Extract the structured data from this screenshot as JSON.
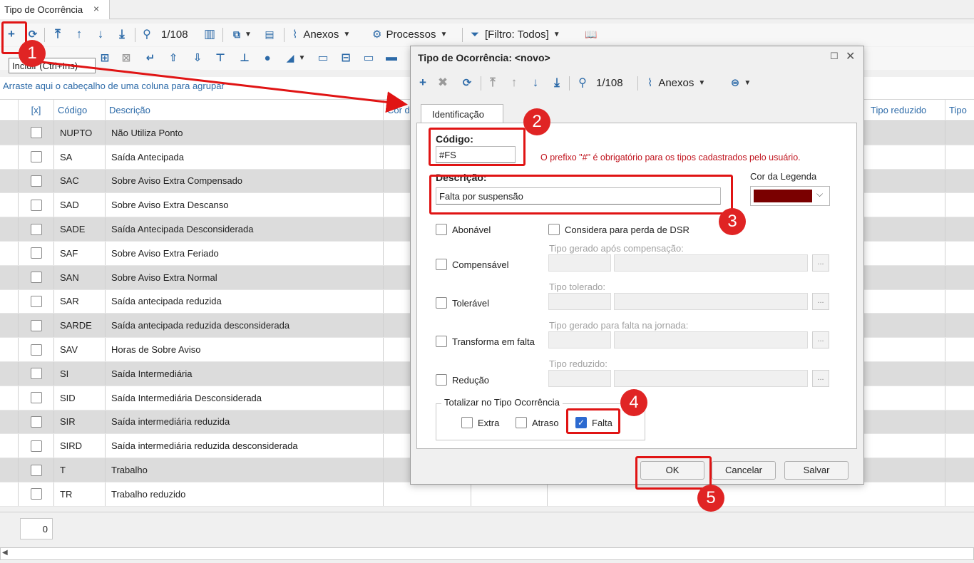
{
  "tab": {
    "title": "Tipo de Ocorrência",
    "close": "×"
  },
  "toolbar": {
    "counter": "1/108",
    "anexos": "Anexos",
    "processos": "Processos",
    "filtro": "[Filtro: Todos]"
  },
  "tooltip": "Incluir (Ctrl+Ins)",
  "group_hint": "Arraste aqui o cabeçalho de uma coluna para agrupar",
  "grid": {
    "columns": [
      "[x]",
      "Código",
      "Descrição",
      "Cor d",
      "Tipo reduzido",
      "Tipo to"
    ],
    "rows": [
      {
        "code": "NUPTO",
        "desc": "Não Utiliza Ponto"
      },
      {
        "code": "SA",
        "desc": "Saída Antecipada"
      },
      {
        "code": "SAC",
        "desc": "Sobre Aviso Extra Compensado"
      },
      {
        "code": "SAD",
        "desc": "Sobre Aviso Extra Descanso"
      },
      {
        "code": "SADE",
        "desc": "Saída Antecipada Desconsiderada"
      },
      {
        "code": "SAF",
        "desc": "Sobre Aviso Extra Feriado"
      },
      {
        "code": "SAN",
        "desc": "Sobre Aviso Extra Normal"
      },
      {
        "code": "SAR",
        "desc": "Saída antecipada reduzida"
      },
      {
        "code": "SARDE",
        "desc": "Saída antecipada reduzida desconsiderada"
      },
      {
        "code": "SAV",
        "desc": "Horas de Sobre Aviso"
      },
      {
        "code": "SI",
        "desc": "Saída Intermediária"
      },
      {
        "code": "SID",
        "desc": "Saída Intermediária Desconsiderada"
      },
      {
        "code": "SIR",
        "desc": "Saída intermediária reduzida"
      },
      {
        "code": "SIRD",
        "desc": "Saída intermediária reduzida desconsiderada"
      },
      {
        "code": "T",
        "desc": "Trabalho"
      },
      {
        "code": "TR",
        "desc": "Trabalho reduzido"
      }
    ],
    "footer_count": "0"
  },
  "dialog": {
    "title": "Tipo de Ocorrência: <novo>",
    "counter": "1/108",
    "anexos": "Anexos",
    "tab": "Identificação",
    "codigo_label": "Código:",
    "codigo_value": "#FS",
    "prefix_hint": "O prefixo \"#\" é obrigatório para os tipos cadastrados pelo usuário.",
    "descricao_label": "Descrição:",
    "descricao_value": "Falta por suspensão",
    "cor_legenda_label": "Cor da Legenda",
    "cor_legenda_color": "#7a0000",
    "abonavel": "Abonável",
    "considera_dsr": "Considera para perda de DSR",
    "compensavel": "Compensável",
    "tipo_apos_compensacao": "Tipo gerado após compensação:",
    "toleravel": "Tolerável",
    "tipo_tolerado": "Tipo tolerado:",
    "transforma_falta": "Transforma em falta",
    "tipo_falta_jornada": "Tipo gerado para falta na jornada:",
    "reducao": "Redução",
    "tipo_reduzido": "Tipo reduzido:",
    "totalizar_label": "Totalizar no Tipo Ocorrência",
    "extra": "Extra",
    "atraso": "Atraso",
    "falta": "Falta",
    "ok": "OK",
    "cancelar": "Cancelar",
    "salvar": "Salvar",
    "dots": "..."
  },
  "badges": [
    "1",
    "2",
    "3",
    "4",
    "5"
  ],
  "colors": {
    "accent": "#2c6aa8",
    "annotation": "#e01414"
  }
}
